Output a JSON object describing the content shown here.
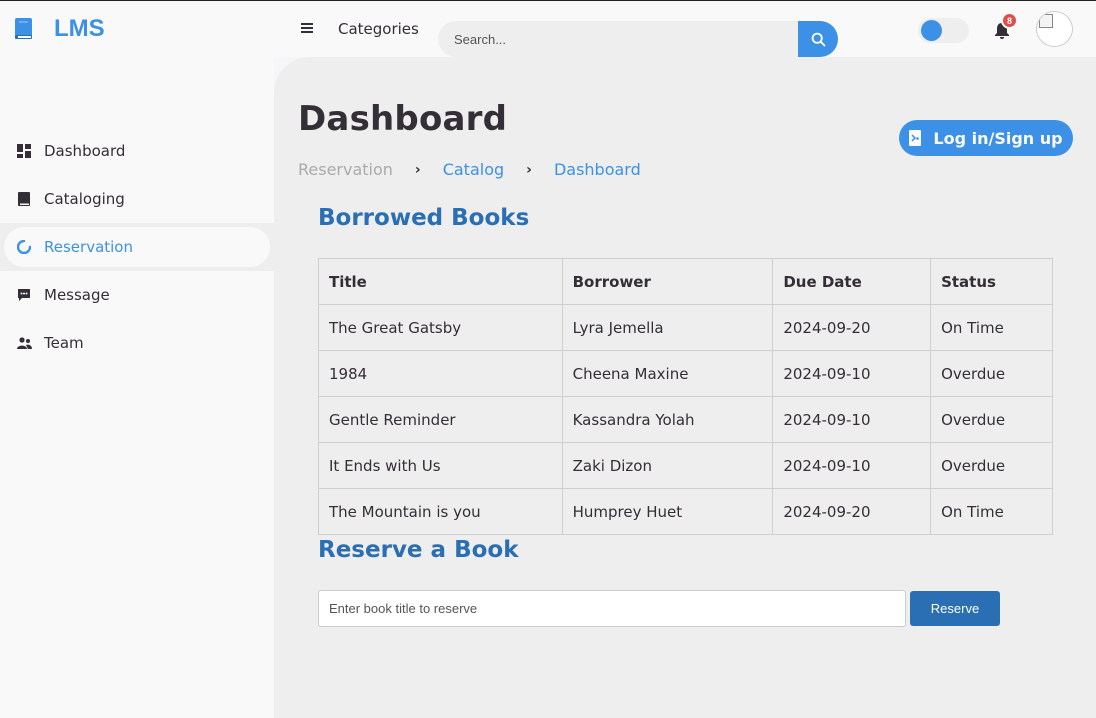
{
  "brand": {
    "name": "LMS",
    "icon": "book-icon",
    "accent": "#3c91e6"
  },
  "sidebar": {
    "items": [
      {
        "label": "Dashboard",
        "icon": "dashboard-icon",
        "active": false
      },
      {
        "label": "Cataloging",
        "icon": "book-icon",
        "active": false
      },
      {
        "label": "Reservation",
        "icon": "loader-icon",
        "active": true
      },
      {
        "label": "Message",
        "icon": "message-icon",
        "active": false
      },
      {
        "label": "Team",
        "icon": "team-icon",
        "active": false
      }
    ]
  },
  "navbar": {
    "menu_icon": "menu-icon",
    "categories_label": "Categories",
    "search_placeholder": "Search...",
    "search_icon": "search-icon",
    "notification_count": "8",
    "notification_icon": "bell-icon",
    "badge_color": "#db504a"
  },
  "main": {
    "title": "Dashboard",
    "breadcrumb": [
      "Reservation",
      "Catalog",
      "Dashboard"
    ],
    "login_button": "Log in/Sign up",
    "borrowed": {
      "title": "Borrowed Books",
      "columns": [
        "Title",
        "Borrower",
        "Due Date",
        "Status"
      ],
      "rows": [
        [
          "The Great Gatsby",
          "Lyra Jemella",
          "2024-09-20",
          "On Time"
        ],
        [
          "1984",
          "Cheena Maxine",
          "2024-09-10",
          "Overdue"
        ],
        [
          "Gentle Reminder",
          "Kassandra Yolah",
          "2024-09-10",
          "Overdue"
        ],
        [
          "It Ends with Us",
          "Zaki Dizon",
          "2024-09-10",
          "Overdue"
        ],
        [
          "The Mountain is you",
          "Humprey Huet",
          "2024-09-20",
          "On Time"
        ]
      ]
    },
    "reserve": {
      "title": "Reserve a Book",
      "placeholder": "Enter book title to reserve",
      "button": "Reserve"
    }
  }
}
